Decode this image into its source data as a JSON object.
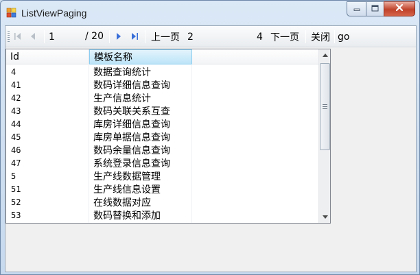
{
  "window": {
    "title": "ListViewPaging",
    "icons": {
      "app": "app-icon",
      "minimize": "minimize-icon",
      "maximize": "maximize-icon",
      "close": "close-icon"
    }
  },
  "toolbar": {
    "icons": [
      "first-page-icon",
      "previous-page-icon",
      "next-page-icon",
      "last-page-icon"
    ],
    "current_page": "1",
    "total_pages": "/ 20",
    "prev_label": "上一页",
    "page_input": "2",
    "page_size": "4",
    "next_label": "下一页",
    "close_label": "关闭",
    "go_label": "go"
  },
  "listview": {
    "columns": [
      "Id",
      "模板名称"
    ],
    "rows": [
      [
        "4",
        "数据查询统计"
      ],
      [
        "41",
        "数码详细信息查询"
      ],
      [
        "42",
        "生产信息统计"
      ],
      [
        "43",
        "数码关联关系互查"
      ],
      [
        "44",
        "库房详细信息查询"
      ],
      [
        "45",
        "库房单据信息查询"
      ],
      [
        "46",
        "数码余量信息查询"
      ],
      [
        "47",
        "系统登录信息查询"
      ],
      [
        "5",
        "生产线数据管理"
      ],
      [
        "51",
        "生产线信息设置"
      ],
      [
        "52",
        "在线数据对应"
      ],
      [
        "53",
        "数码替换和添加"
      ]
    ]
  },
  "colors": {
    "header_highlight": "#bce4f8",
    "close_button": "#c0422a",
    "toolbar_icon": "#3a6fd8"
  }
}
